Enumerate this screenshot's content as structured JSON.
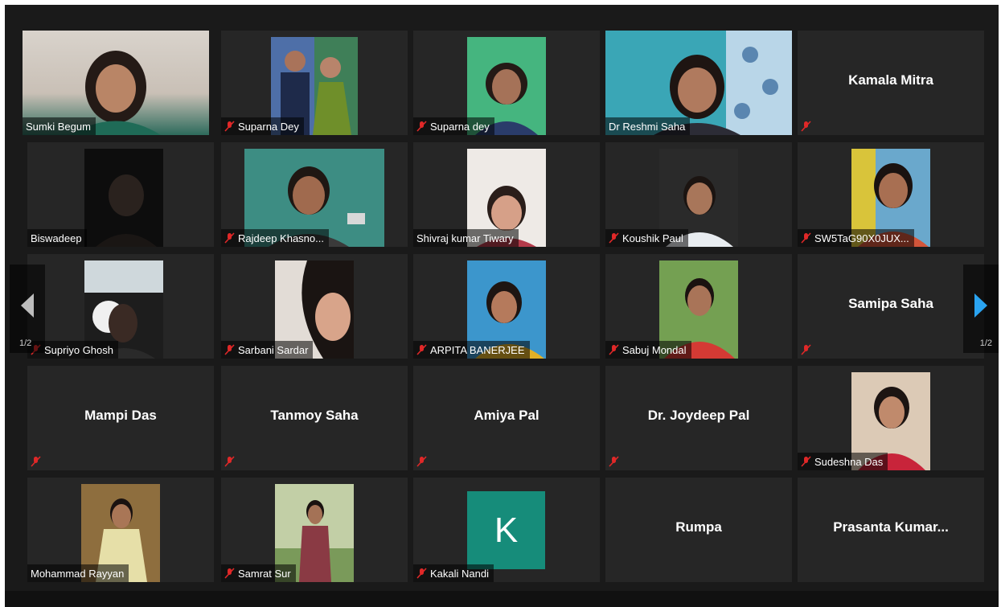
{
  "meeting": {
    "page_indicator_left": "1/2",
    "page_indicator_right": "1/2",
    "active_speaker_color": "#c9df4f",
    "mute_icon_color": "#e02828",
    "avatar_color": "#168c7a"
  },
  "participants": [
    {
      "name": "Sumki Begum",
      "muted": false
    },
    {
      "name": "Suparna Dey",
      "muted": true
    },
    {
      "name": "Suparna dey",
      "muted": true
    },
    {
      "name": "Dr Reshmi Saha",
      "muted": false
    },
    {
      "name": "Kamala Mitra",
      "muted": true
    },
    {
      "name": "Biswadeep",
      "muted": false
    },
    {
      "name": "Rajdeep Khasno...",
      "muted": true
    },
    {
      "name": "Shivraj kumar Tiwary",
      "muted": false
    },
    {
      "name": "Koushik Paul",
      "muted": true
    },
    {
      "name": "SW5TaG90X0JUX...",
      "muted": true
    },
    {
      "name": "Supriyo Ghosh",
      "muted": true
    },
    {
      "name": "Sarbani Sardar",
      "muted": true
    },
    {
      "name": "ARPITA BANERJEE",
      "muted": true
    },
    {
      "name": "Sabuj Mondal",
      "muted": true
    },
    {
      "name": "Samipa Saha",
      "muted": true
    },
    {
      "name": "Mampi Das",
      "muted": true
    },
    {
      "name": "Tanmoy Saha",
      "muted": true
    },
    {
      "name": "Amiya Pal",
      "muted": true
    },
    {
      "name": "Dr. Joydeep Pal",
      "muted": true
    },
    {
      "name": "Sudeshna Das",
      "muted": true
    },
    {
      "name": "Mohammad Rayyan",
      "muted": false
    },
    {
      "name": "Samrat Sur",
      "muted": true
    },
    {
      "name": "Kakali Nandi",
      "muted": true,
      "avatar_letter": "K"
    },
    {
      "name": "Rumpa",
      "muted": false
    },
    {
      "name": "Prasanta Kumar...",
      "muted": false
    }
  ]
}
